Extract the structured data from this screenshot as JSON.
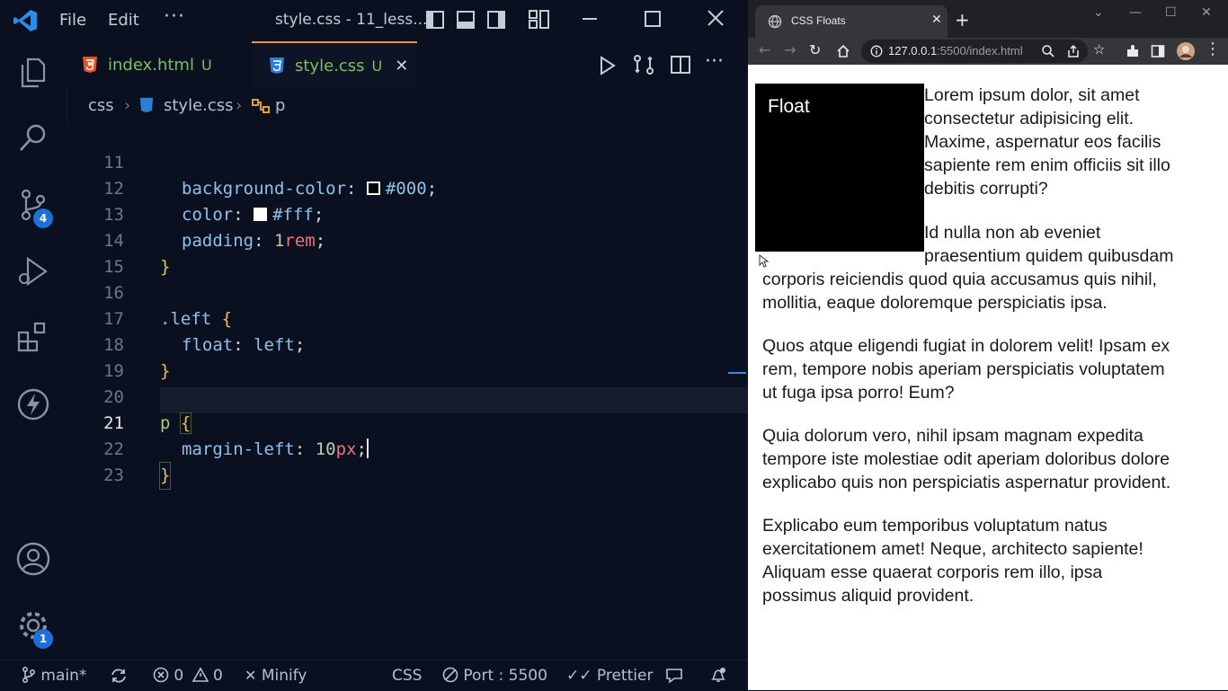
{
  "vscode": {
    "menu": {
      "file": "File",
      "edit": "Edit",
      "more": "···"
    },
    "window_title": "style.css - 11_less...",
    "tabs": [
      {
        "icon": "html5-icon",
        "name": "index.html",
        "status": "U"
      },
      {
        "icon": "css3-icon",
        "name": "style.css",
        "status": "U",
        "close": "✕"
      }
    ],
    "breadcrumb": {
      "folder": "css",
      "file": "style.css",
      "symbol": "p"
    },
    "activity_badges": {
      "source_control": "4",
      "settings": "1"
    },
    "code": {
      "line_numbers": [
        "11",
        "12",
        "13",
        "14",
        "15",
        "16",
        "17",
        "18",
        "19",
        "20",
        "21",
        "22",
        "23"
      ],
      "l11_prop": "background-color",
      "l11_val": "#000",
      "l12_prop": "color",
      "l12_val": "#fff",
      "l13_prop": "padding",
      "l13_num": "1",
      "l13_unit": "rem",
      "close_brace": "}",
      "l16_sel": ".left",
      "open_brace": "{",
      "l17_prop": "float",
      "l17_val": "left",
      "l20_sel": "p",
      "l21_prop": "margin-left",
      "l21_num": "10",
      "l21_unit": "px"
    },
    "status": {
      "branch": "main*",
      "errors": "0",
      "warnings": "0",
      "minify": "Minify",
      "language": "CSS",
      "port": "Port : 5500",
      "prettier": "Prettier"
    }
  },
  "browser": {
    "tab_title": "CSS Floats",
    "url_host": "127.0.0.1",
    "url_path": ":5500/index.html",
    "float_label": "Float",
    "paragraphs": [
      [
        "Lorem ipsum dolor, sit amet",
        "consectetur adipisicing elit.",
        "Maxime, aspernatur eos facilis",
        "sapiente rem enim officiis sit illo",
        "debitis corrupti?"
      ],
      [
        "Id nulla non ab eveniet",
        "praesentium quidem quibusdam",
        "corporis reiciendis quod quia accusamus quis nihil,",
        "mollitia, eaque doloremque perspiciatis ipsa."
      ],
      [
        "Quos atque eligendi fugiat in dolorem velit! Ipsam ex",
        "rem, tempore nobis aperiam perspiciatis voluptatem",
        "ut fuga ipsa porro! Eum?"
      ],
      [
        "Quia dolorum vero, nihil ipsam magnam expedita",
        "tempore iste molestiae odit aperiam doloribus dolore",
        "explicabo quis non perspiciatis aspernatur provident."
      ],
      [
        "Explicabo eum temporibus voluptatum natus",
        "exercitationem amet! Neque, architecto sapiente!",
        "Aliquam esse quaerat corporis rem illo, ipsa",
        "possimus aliquid provident."
      ]
    ]
  }
}
